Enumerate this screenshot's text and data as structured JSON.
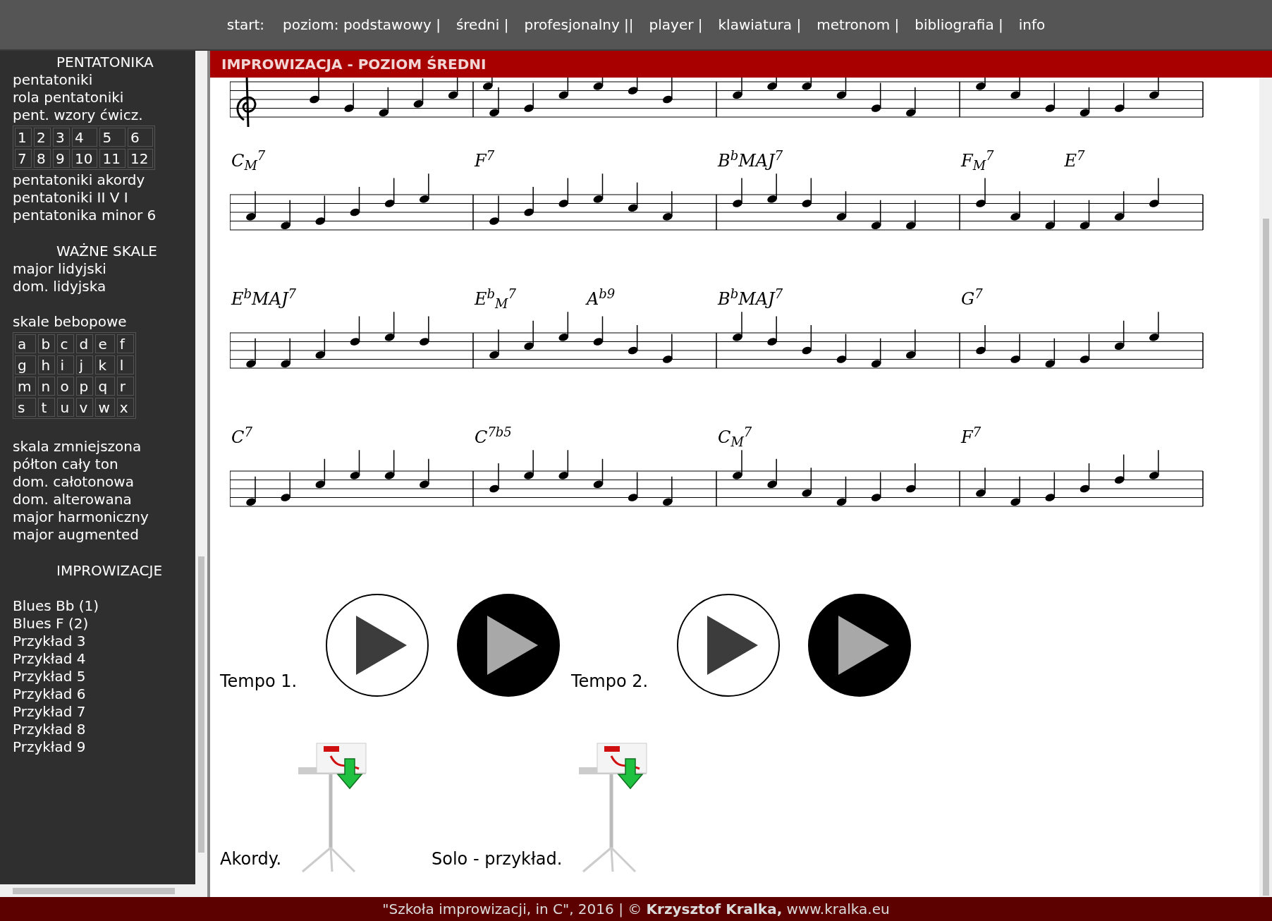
{
  "nav": {
    "label": "start:",
    "items": [
      "poziom: podstawowy |",
      "średni |",
      "profesjonalny ||",
      "player |",
      "klawiatura |",
      "metronom |",
      "bibliografia |",
      "info"
    ]
  },
  "sidebar": {
    "sections": [
      {
        "title": "PENTATONIKA",
        "items": [
          {
            "kind": "link",
            "label": "pentatoniki"
          },
          {
            "kind": "link",
            "label": "rola pentatoniki"
          },
          {
            "kind": "link",
            "label": "pent. wzory ćwicz."
          },
          {
            "kind": "grid",
            "rows": [
              [
                "1",
                "2",
                "3",
                "4",
                "5",
                "6"
              ],
              [
                "7",
                "8",
                "9",
                "10",
                "11",
                "12"
              ]
            ]
          },
          {
            "kind": "link",
            "label": "pentatoniki akordy"
          },
          {
            "kind": "link",
            "label": "pentatoniki II V I"
          },
          {
            "kind": "link",
            "label": "pentatonika minor 6"
          }
        ]
      },
      {
        "title": "WAŻNE SKALE",
        "items": [
          {
            "kind": "link",
            "label": "major lidyjski"
          },
          {
            "kind": "link",
            "label": "dom. lidyjska"
          },
          {
            "kind": "gap"
          },
          {
            "kind": "link",
            "label": "skale bebopowe"
          },
          {
            "kind": "grid",
            "rows": [
              [
                "a",
                "b",
                "c",
                "d",
                "e",
                "f"
              ],
              [
                "g",
                "h",
                "i",
                "j",
                "k",
                "l"
              ],
              [
                "m",
                "n",
                "o",
                "p",
                "q",
                "r"
              ],
              [
                "s",
                "t",
                "u",
                "v",
                "w",
                "x"
              ]
            ]
          },
          {
            "kind": "gap"
          },
          {
            "kind": "link",
            "label": "skala zmniejszona"
          },
          {
            "kind": "link",
            "label": "półton cały ton"
          },
          {
            "kind": "link",
            "label": "dom. całotonowa"
          },
          {
            "kind": "link",
            "label": "dom. alterowana"
          },
          {
            "kind": "link",
            "label": "major harmoniczny"
          },
          {
            "kind": "link",
            "label": "major augmented"
          }
        ]
      },
      {
        "title": "IMPROWIZACJE",
        "items": [
          {
            "kind": "gap"
          },
          {
            "kind": "link",
            "label": "Blues Bb (1)"
          },
          {
            "kind": "link",
            "label": "Blues F (2)"
          },
          {
            "kind": "link",
            "label": "Przykład 3"
          },
          {
            "kind": "link",
            "label": "Przykład 4"
          },
          {
            "kind": "link",
            "label": "Przykład 5"
          },
          {
            "kind": "link",
            "label": "Przykład 6"
          },
          {
            "kind": "link",
            "label": "Przykład 7"
          },
          {
            "kind": "link",
            "label": "Przykład 8"
          },
          {
            "kind": "link",
            "label": "Przykład 9"
          }
        ]
      }
    ]
  },
  "header": {
    "title": "IMPROWIZACJA - POZIOM ŚREDNI"
  },
  "score": {
    "staves": [
      {
        "kind": "partial"
      },
      {
        "measures": [
          [
            "C$_{M}$$^{7}$"
          ],
          [
            "F$^{7}$"
          ],
          [
            "B$^{b}$MAJ$^{7}$"
          ],
          [
            "F$_{M}$$^{7}$",
            "E$^{7}$"
          ]
        ]
      },
      {
        "measures": [
          [
            "E$^{b}$MAJ$^{7}$"
          ],
          [
            "E$^{b}$$_{M}$$^{7}$",
            "A$^{b9}$"
          ],
          [
            "B$^{b}$MAJ$^{7}$"
          ],
          [
            "G$^{7}$"
          ]
        ]
      },
      {
        "measures": [
          [
            "C$^{7}$"
          ],
          [
            "C$^{7b5}$"
          ],
          [
            "C$_{M}$$^{7}$"
          ],
          [
            "F$^{7}$"
          ]
        ]
      }
    ]
  },
  "players": [
    {
      "label": "Tempo 1.",
      "buttons": [
        {
          "kind": "light"
        },
        {
          "kind": "dark"
        }
      ]
    },
    {
      "label": "Tempo 2.",
      "buttons": [
        {
          "kind": "light"
        },
        {
          "kind": "dark"
        }
      ]
    }
  ],
  "downloads": [
    {
      "label": "Akordy."
    },
    {
      "label": "Solo - przykład."
    }
  ],
  "footer": {
    "text": "\"Szkoła improwizacji, in C\", 2016 | © **Krzysztof Kralka,** www.kralka.eu"
  }
}
